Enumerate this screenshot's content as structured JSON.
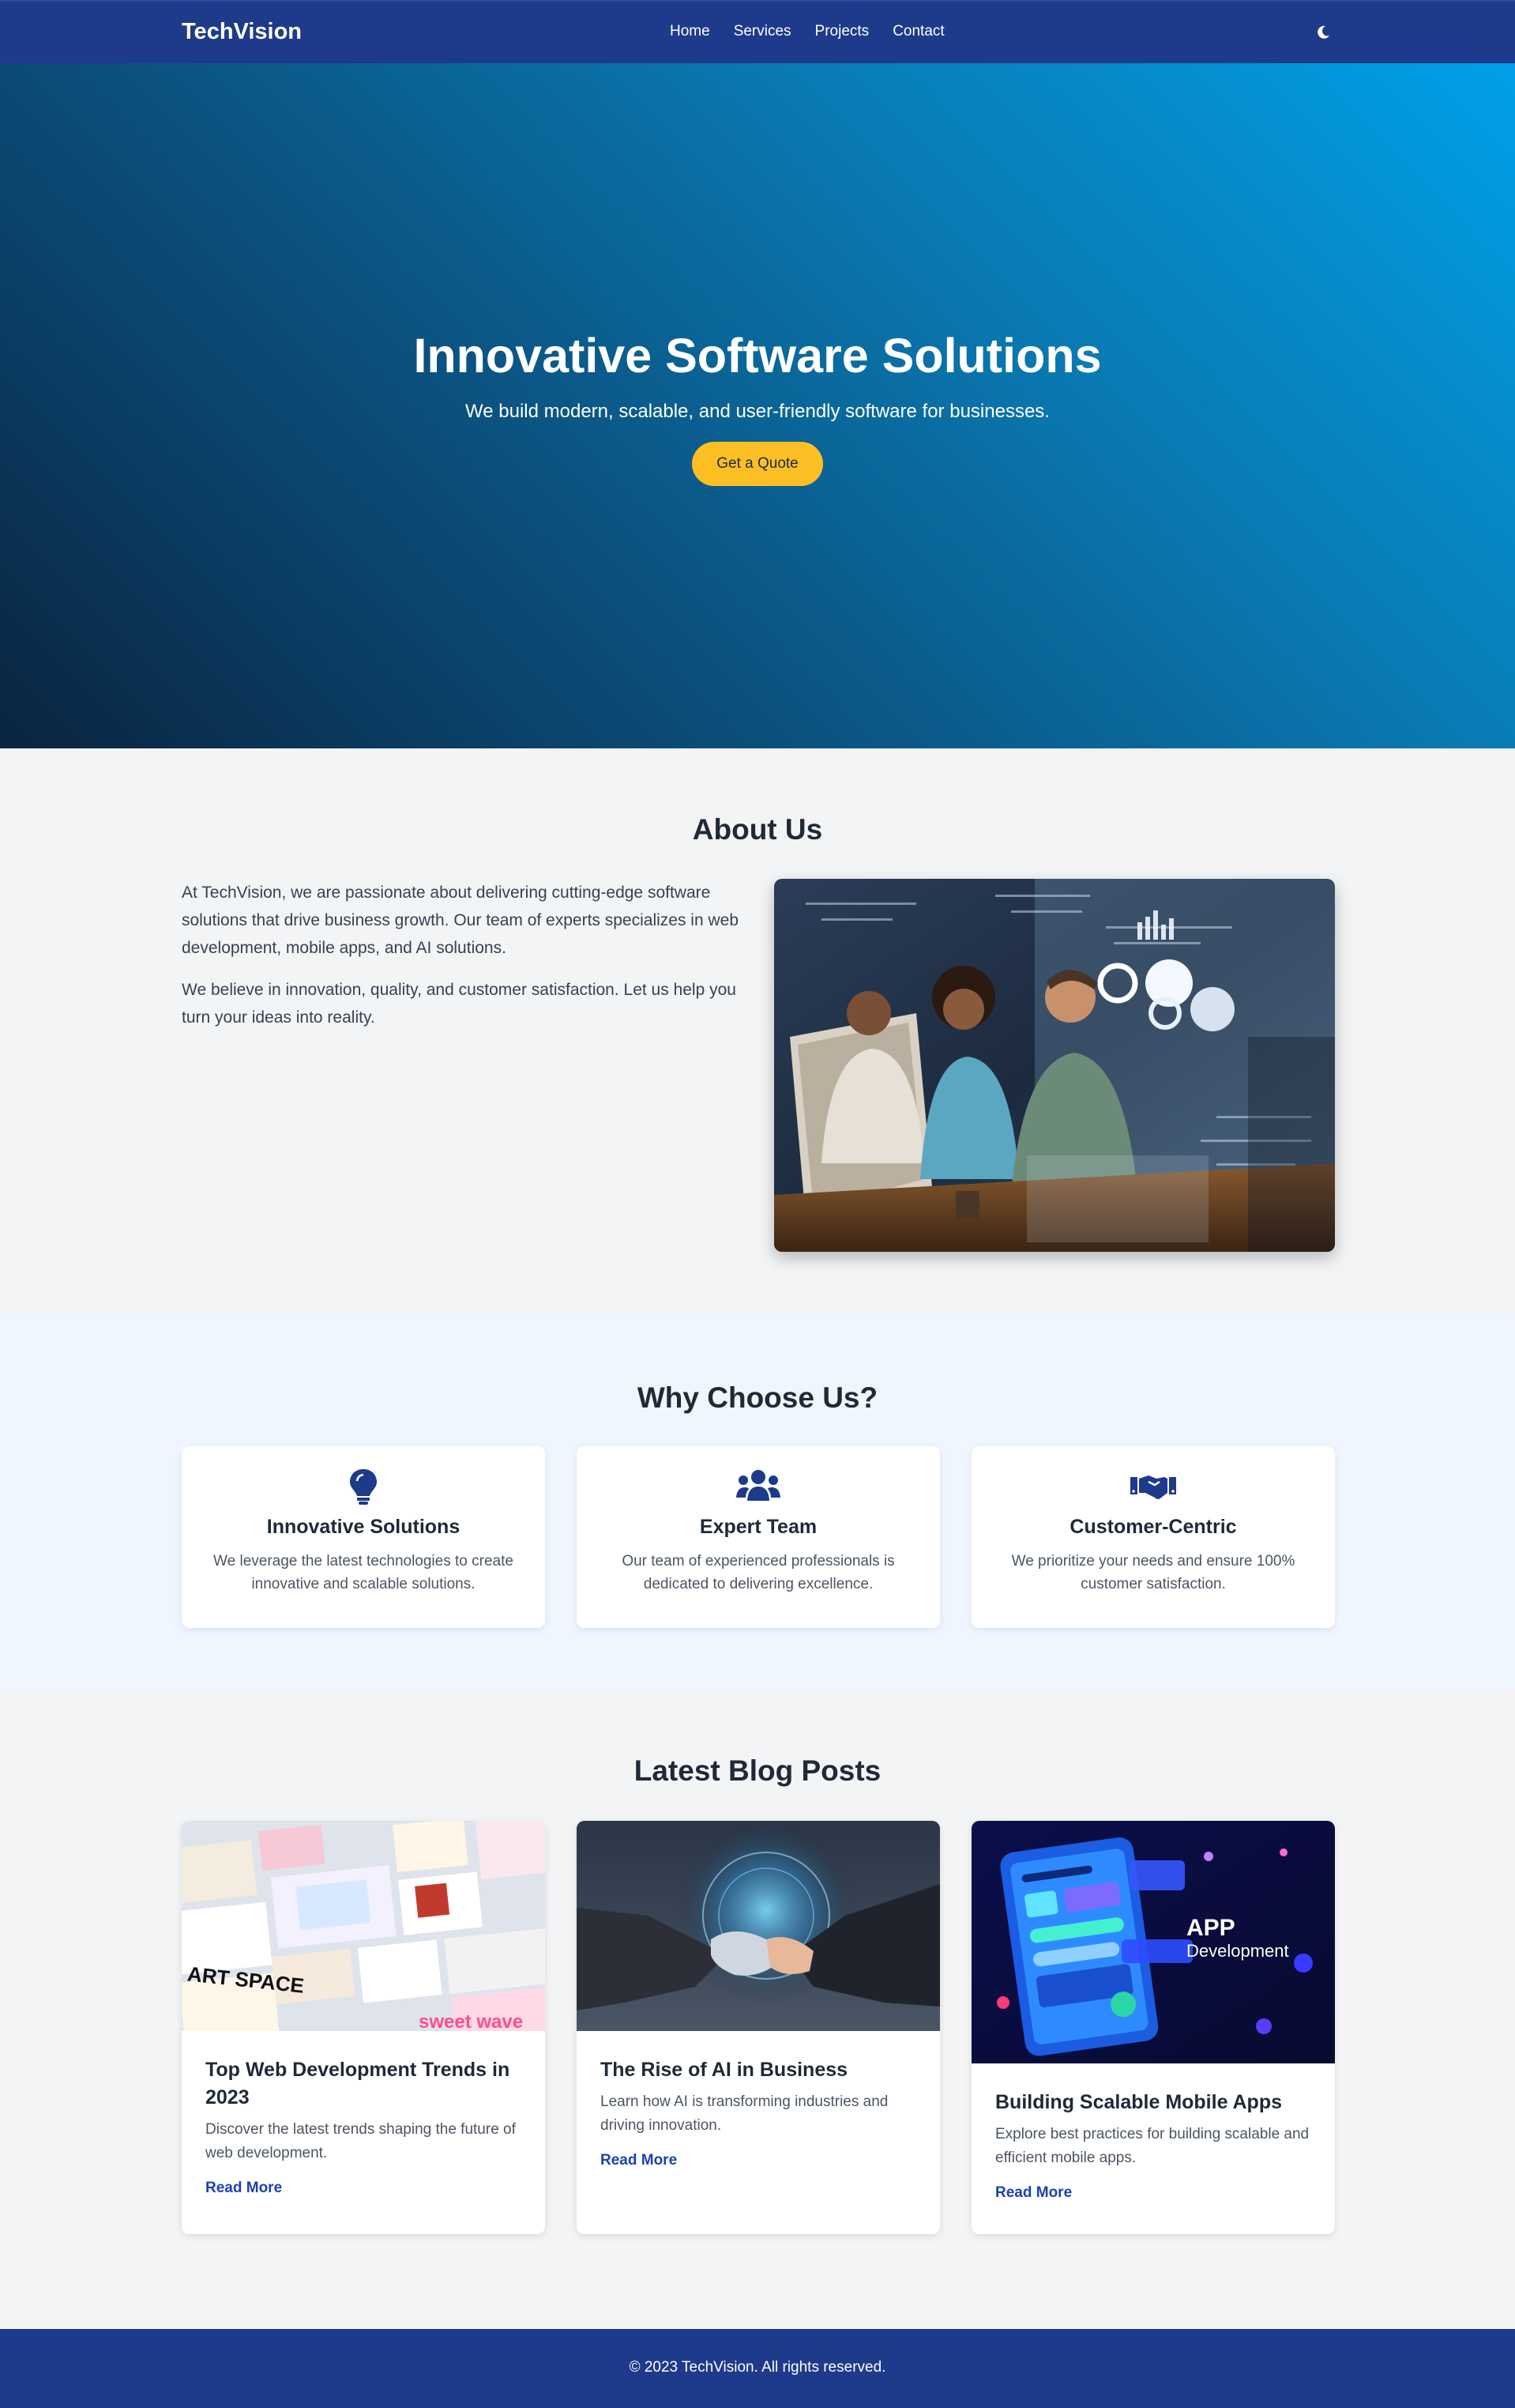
{
  "nav": {
    "brand": "TechVision",
    "links": [
      "Home",
      "Services",
      "Projects",
      "Contact"
    ],
    "theme_icon": "moon-icon"
  },
  "hero": {
    "title": "Innovative Software Solutions",
    "subtitle": "We build modern, scalable, and user-friendly software for businesses.",
    "cta": "Get a Quote"
  },
  "about": {
    "title": "About Us",
    "paragraphs": [
      "At TechVision, we are passionate about delivering cutting-edge software solutions that drive business growth. Our team of experts specializes in web development, mobile apps, and AI solutions.",
      "We believe in innovation, quality, and customer satisfaction. Let us help you turn your ideas into reality."
    ]
  },
  "why": {
    "title": "Why Choose Us?",
    "features": [
      {
        "icon": "lightbulb-icon",
        "title": "Innovative Solutions",
        "desc": "We leverage the latest technologies to create innovative and scalable solutions."
      },
      {
        "icon": "users-icon",
        "title": "Expert Team",
        "desc": "Our team of experienced professionals is dedicated to delivering excellence."
      },
      {
        "icon": "handshake-icon",
        "title": "Customer-Centric",
        "desc": "We prioritize your needs and ensure 100% customer satisfaction."
      }
    ]
  },
  "blog": {
    "title": "Latest Blog Posts",
    "posts": [
      {
        "title": "Top Web Development Trends in 2023",
        "desc": "Discover the latest trends shaping the future of web development.",
        "link": "Read More"
      },
      {
        "title": "The Rise of AI in Business",
        "desc": "Learn how AI is transforming industries and driving innovation.",
        "link": "Read More"
      },
      {
        "title": "Building Scalable Mobile Apps",
        "desc": "Explore best practices for building scalable and efficient mobile apps.",
        "link": "Read More"
      }
    ],
    "image_texts": {
      "art_space": "ART SPACE",
      "sweet_wave": "sweet wave",
      "app": "APP",
      "development": "Development"
    }
  },
  "footer": {
    "text": "© 2023 TechVision. All rights reserved."
  },
  "colors": {
    "primary": "#1e3a8a",
    "accent": "#fbbf24",
    "link": "#1e40af"
  }
}
